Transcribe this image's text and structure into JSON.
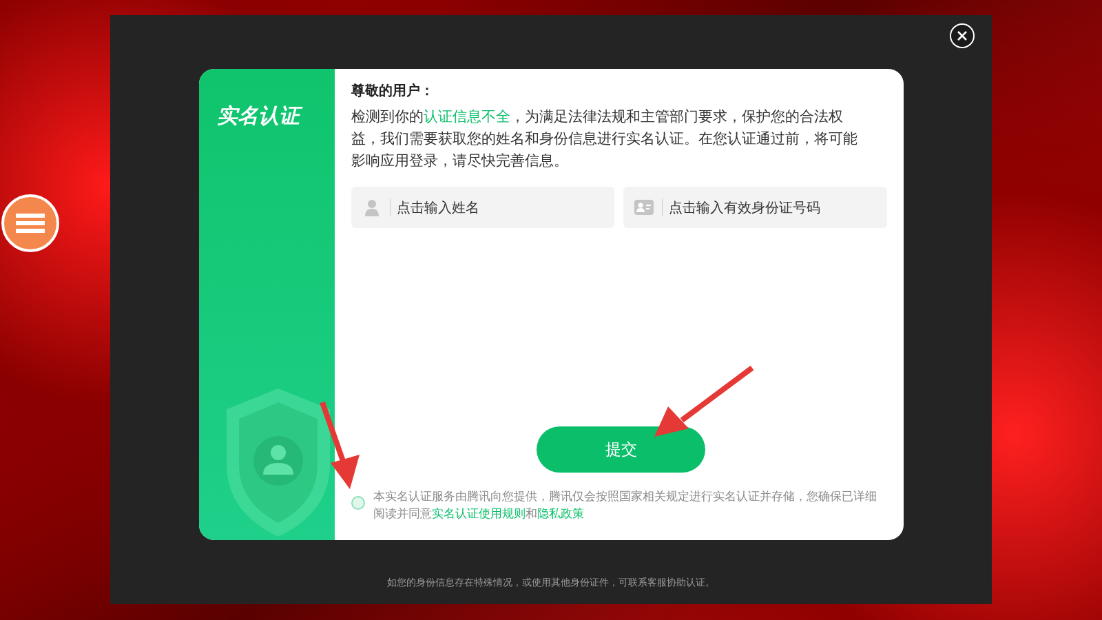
{
  "dialog": {
    "title": "实名认证",
    "greeting": "尊敬的用户：",
    "message": [
      {
        "kind": "plain",
        "text": "检测到你的"
      },
      {
        "kind": "highlight",
        "text": "认证信息不全"
      },
      {
        "kind": "plain",
        "text": "，为满足法律法规和主管部门要求，保护您的合法权益，我们需要获取您的姓名和身份信息进行实名认证。在您认证通过前，将可能影响应用登录，请尽快完善信息。"
      }
    ],
    "fields": [
      {
        "kind": "name",
        "placeholder": "点击输入姓名"
      },
      {
        "kind": "id",
        "placeholder": "点击输入有效身份证号码"
      }
    ],
    "submit": "提交",
    "consent": {
      "checked": false,
      "parts": [
        {
          "kind": "plain",
          "text": "本实名认证服务由腾讯向您提供，腾讯仅会按照国家相关规定进行实名认证并存储，您确保已详细阅读并同意"
        },
        {
          "kind": "link",
          "text": "实名认证使用规则"
        },
        {
          "kind": "plain",
          "text": "和"
        },
        {
          "kind": "link",
          "text": "隐私政策"
        }
      ]
    }
  },
  "footer_note": "如您的身份信息存在特殊情况，或使用其他身份证件，可联系客服协助认证。"
}
